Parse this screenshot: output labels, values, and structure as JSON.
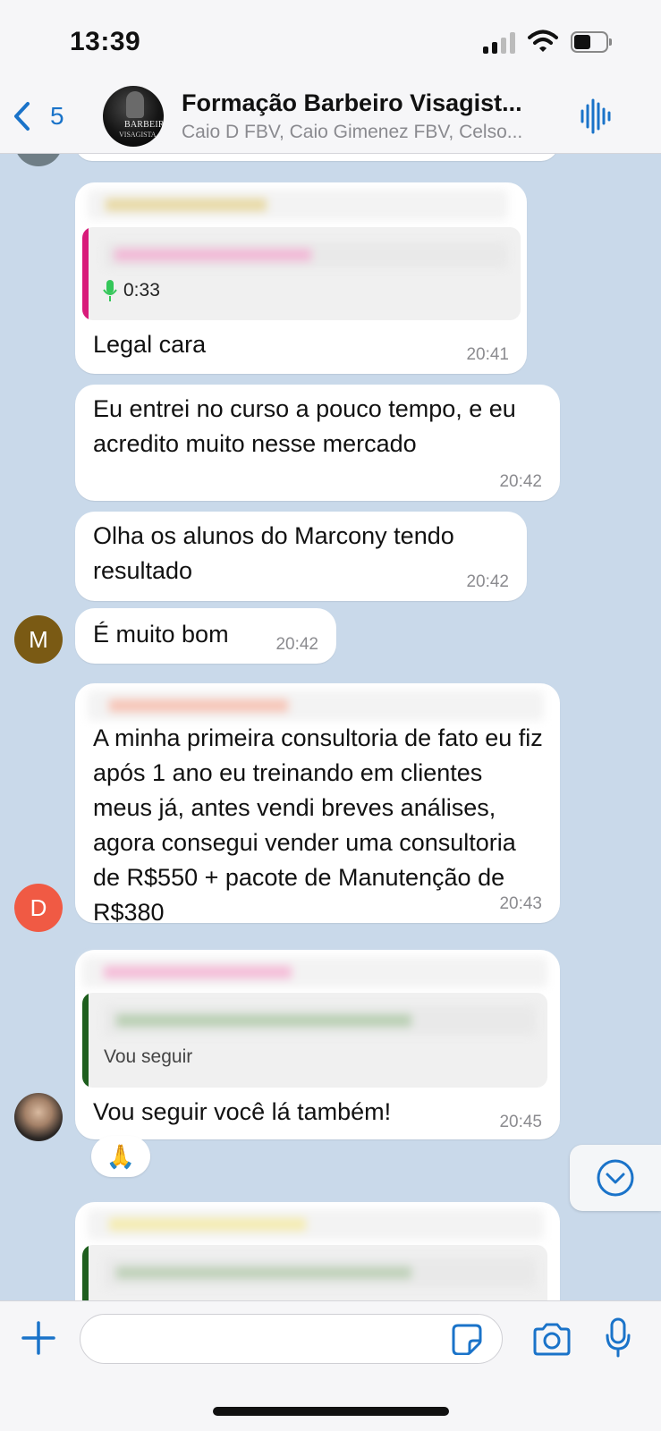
{
  "status_bar": {
    "time": "13:39"
  },
  "header": {
    "back_count": "5",
    "group_name": "Formação Barbeiro Visagist...",
    "members": "Caio D FBV, Caio Gimenez FBV, Celso...",
    "avatar_line1": "BARBEIRO",
    "avatar_line2": "VISAGISTA"
  },
  "messages": [
    {
      "text": "Legal cara",
      "time": "20:41",
      "voice_duration": "0:33"
    },
    {
      "text": "Eu entrei no curso a pouco tempo, e eu acredito muito nesse mercado",
      "time": "20:42"
    },
    {
      "text": "Olha os alunos do Marcony tendo resultado",
      "time": "20:42"
    },
    {
      "text": "É muito bom",
      "time": "20:42",
      "avatar_letter": "M"
    },
    {
      "text": "A minha primeira consultoria de fato eu fiz após 1 ano eu treinando em clientes meus já, antes vendi breves análises, agora consegui vender uma consultoria de R$550 + pacote de Manutenção de R$380",
      "time": "20:43",
      "avatar_letter": "D"
    },
    {
      "text": "Vou seguir você lá também!",
      "time": "20:45",
      "quoted_text": "Vou seguir",
      "reaction": "🙏"
    }
  ],
  "composer": {
    "placeholder": ""
  },
  "colors": {
    "accent": "#1a73c9",
    "chat_background": "#c9d9ea",
    "avatar_m": "#7a5a14",
    "avatar_d": "#f05a44",
    "quote_bar_pink": "#d81b7a",
    "quote_bar_green": "#1e5e1e",
    "mic_green": "#34c759"
  },
  "icons": [
    "back-chevron-icon",
    "sound-wave-icon",
    "mic-icon",
    "praying-hands-emoji",
    "chevron-down-icon",
    "plus-icon",
    "sticker-icon",
    "camera-icon",
    "microphone-icon"
  ]
}
